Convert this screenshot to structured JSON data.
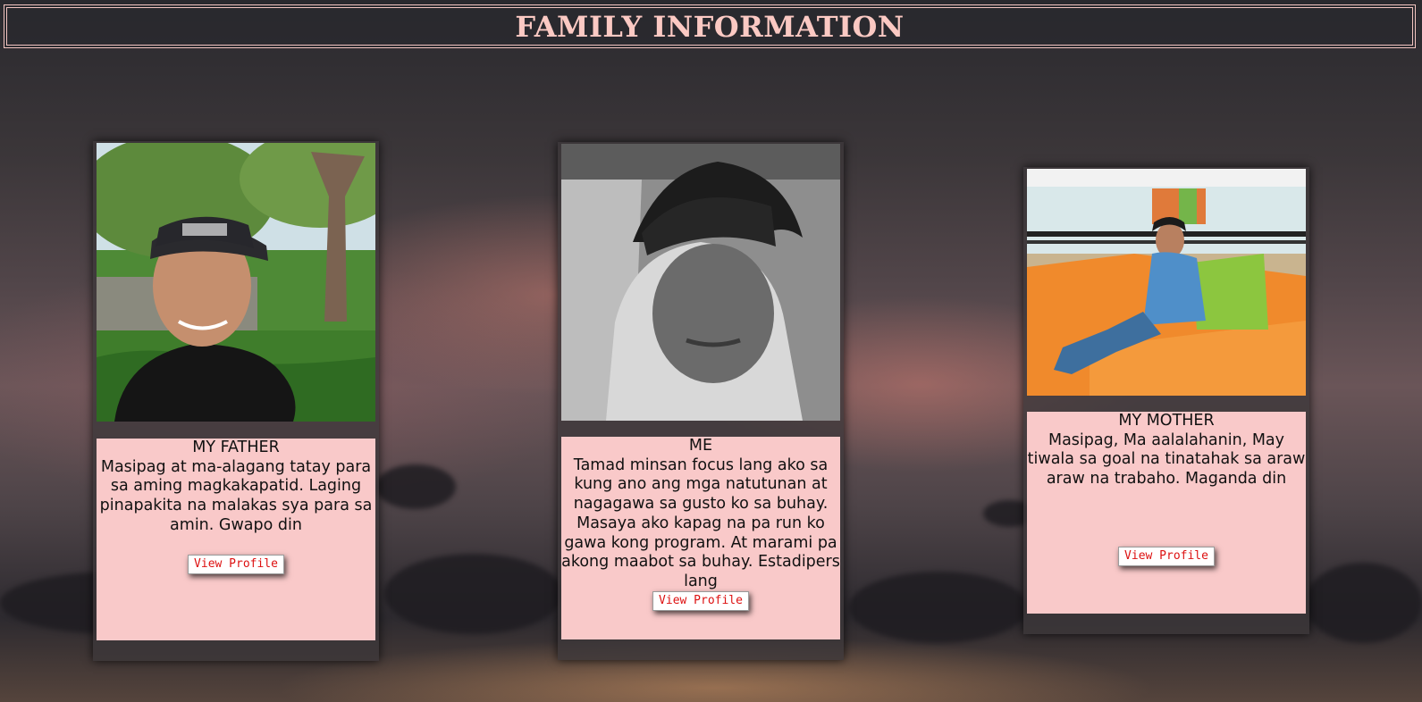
{
  "page": {
    "title": "FAMILY INFORMATION"
  },
  "cards": [
    {
      "name": "MY FATHER",
      "description": "Masipag at ma-alagang tatay para sa aming magkakapatid. Laging pinapakita na malakas sya para sa amin. Gwapo din",
      "button_label": "View Profile"
    },
    {
      "name": "ME",
      "description": "Tamad minsan focus lang ako sa kung ano ang mga natutunan at nagagawa sa gusto ko sa buhay. Masaya ako kapag na pa run ko gawa kong program. At marami pa akong maabot sa buhay. Estadipers lang",
      "button_label": "View Profile"
    },
    {
      "name": "MY MOTHER",
      "description": "Masipag, Ma aalalahanin, May tiwala sa goal na tinatahak sa araw araw na trabaho. Maganda din",
      "button_label": "View Profile"
    }
  ],
  "colors": {
    "header_text": "#fbc9c3",
    "card_info_bg": "#f9c9c9",
    "button_text": "#dd1111"
  }
}
